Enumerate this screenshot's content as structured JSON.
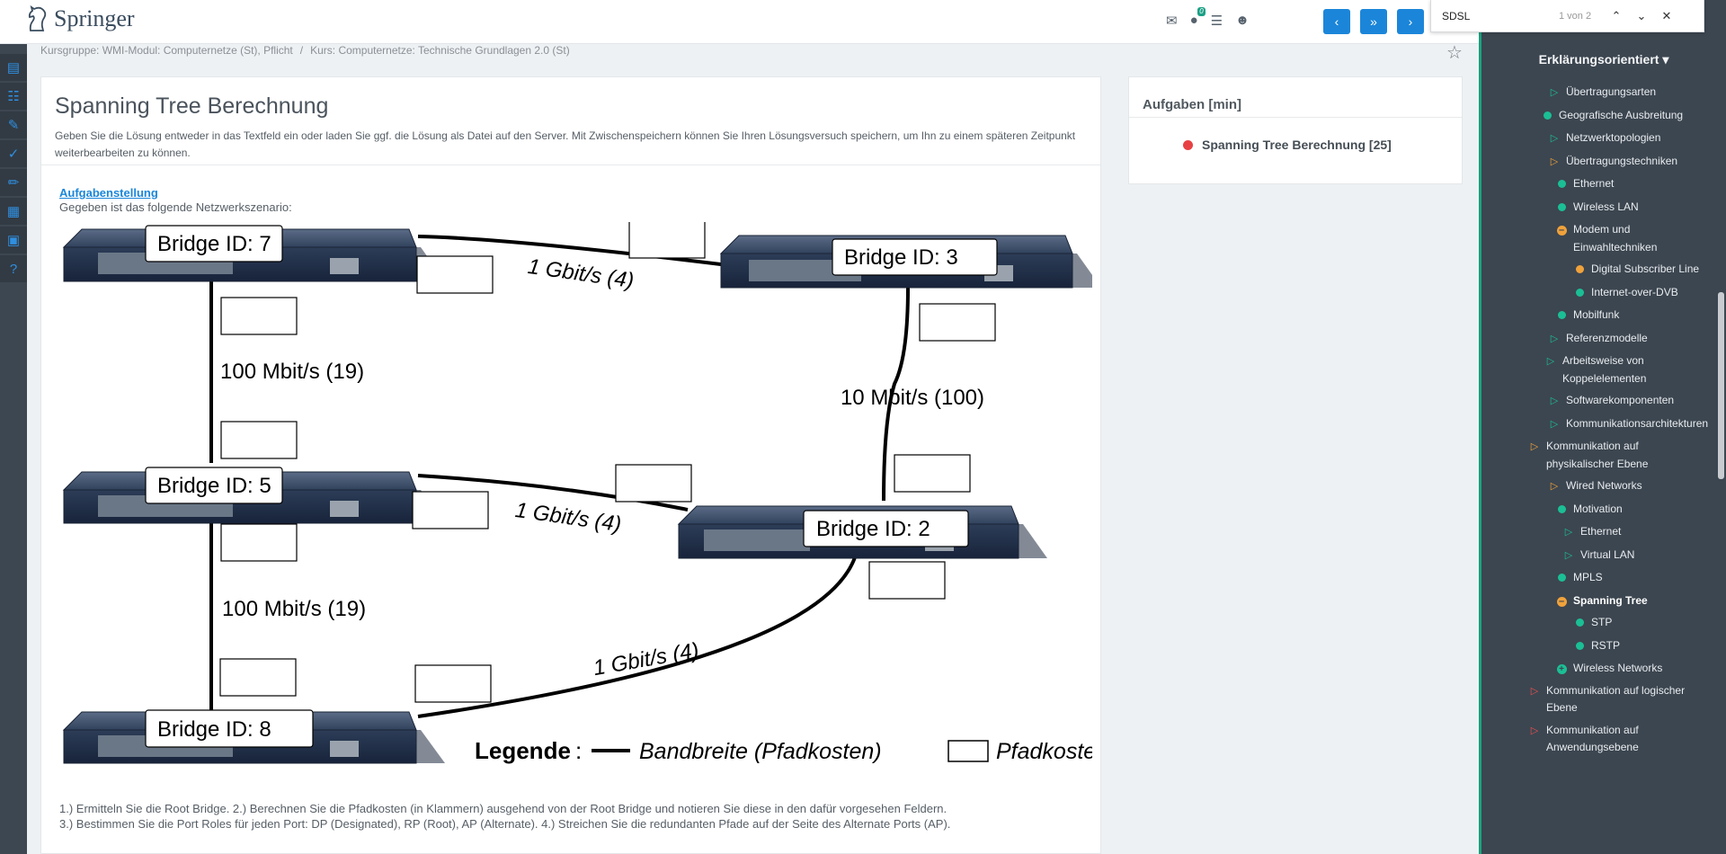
{
  "logo": {
    "text": "Springer"
  },
  "topbar": {
    "notification_count": "0",
    "nav_prev": "‹",
    "nav_next": "›",
    "nav_down": "»"
  },
  "find": {
    "value": "SDSL",
    "count": "1 von 2"
  },
  "breadcrumb": {
    "group": "Kursgruppe: WMI-Modul: Computernetze (St), Pflicht",
    "course": "Kurs: Computernetze: Technische Grundlagen 2.0 (St)"
  },
  "page": {
    "title": "Spanning Tree Berechnung",
    "intro": "Geben Sie die Lösung entweder in das Textfeld ein oder laden Sie ggf. die Lösung als Datei auf den Server. Mit Zwischenspeichern können Sie Ihren Lösungsversuch speichern, um Ihn zu einem späteren Zeitpunkt weiterbearbeiten zu können."
  },
  "task": {
    "heading": "Aufgabenstellung",
    "subheading": "Gegeben ist das folgende Netzwerkszenario:",
    "bridges": [
      {
        "label": "Bridge ID: 7"
      },
      {
        "label": "Bridge ID: 3"
      },
      {
        "label": "Bridge ID: 5"
      },
      {
        "label": "Bridge ID: 2"
      },
      {
        "label": "Bridge ID: 8"
      }
    ],
    "links": [
      {
        "label": "1 Gbit/s (4)"
      },
      {
        "label": "100 Mbit/s (19)"
      },
      {
        "label": "10 Mbit/s (100)"
      },
      {
        "label": "1 Gbit/s (4)"
      },
      {
        "label": "100 Mbit/s (19)"
      },
      {
        "label": "1 Gbit/s (4)"
      }
    ],
    "legend": {
      "title": "Legende",
      "line": "Bandbreite (Pfadkosten)",
      "box": "Pfadkosten"
    },
    "instruction_1": "1.) Ermitteln Sie die Root Bridge. 2.) Berechnen Sie die Pfadkosten (in Klammern) ausgehend von der Root Bridge und notieren Sie diese in den dafür vorgesehen Feldern.",
    "instruction_2": "3.) Bestimmen Sie die Port Roles für jeden Port: DP (Designated), RP (Root), AP (Alternate). 4.) Streichen Sie die redundanten Pfade auf der Seite des Alternate Ports (AP)."
  },
  "aufgaben": {
    "title": "Aufgaben [min]",
    "items": [
      {
        "label": "Spanning Tree Berechnung [25]",
        "status_color": "#e84143"
      }
    ]
  },
  "sidebar": {
    "header": "Erklärungsorientiert",
    "items": [
      {
        "label": "Übertragungsarten",
        "icon": "play"
      },
      {
        "label": "Geografische Ausbreitung",
        "icon": "dot"
      },
      {
        "label": "Netzwerktopologien",
        "icon": "play"
      },
      {
        "label": "Übertragungstechniken",
        "icon": "play-open"
      },
      {
        "label": "Ethernet",
        "icon": "dot"
      },
      {
        "label": "Wireless LAN",
        "icon": "dot"
      },
      {
        "label": "Modem und Einwahltechniken",
        "icon": "minus"
      },
      {
        "label": "Digital Subscriber Line",
        "icon": "dot-orange"
      },
      {
        "label": "Internet-over-DVB",
        "icon": "dot"
      },
      {
        "label": "Mobilfunk",
        "icon": "dot"
      },
      {
        "label": "Referenzmodelle",
        "icon": "play"
      },
      {
        "label": "Arbeitsweise von Koppelelementen",
        "icon": "play"
      },
      {
        "label": "Softwarekomponenten",
        "icon": "play"
      },
      {
        "label": "Kommunikationsarchitekturen",
        "icon": "play"
      },
      {
        "label": "Kommunikation auf physikalischer Ebene",
        "icon": "play-open"
      },
      {
        "label": "Wired Networks",
        "icon": "play-open"
      },
      {
        "label": "Motivation",
        "icon": "dot"
      },
      {
        "label": "Ethernet",
        "icon": "play"
      },
      {
        "label": "Virtual LAN",
        "icon": "play"
      },
      {
        "label": "MPLS",
        "icon": "dot"
      },
      {
        "label": "Spanning Tree",
        "icon": "minus"
      },
      {
        "label": "STP",
        "icon": "dot"
      },
      {
        "label": "RSTP",
        "icon": "dot"
      },
      {
        "label": "Wireless Networks",
        "icon": "plus"
      },
      {
        "label": "Kommunikation auf logischer Ebene",
        "icon": "play-red"
      },
      {
        "label": "Kommunikation auf Anwendungsebene",
        "icon": "play-red"
      }
    ]
  }
}
